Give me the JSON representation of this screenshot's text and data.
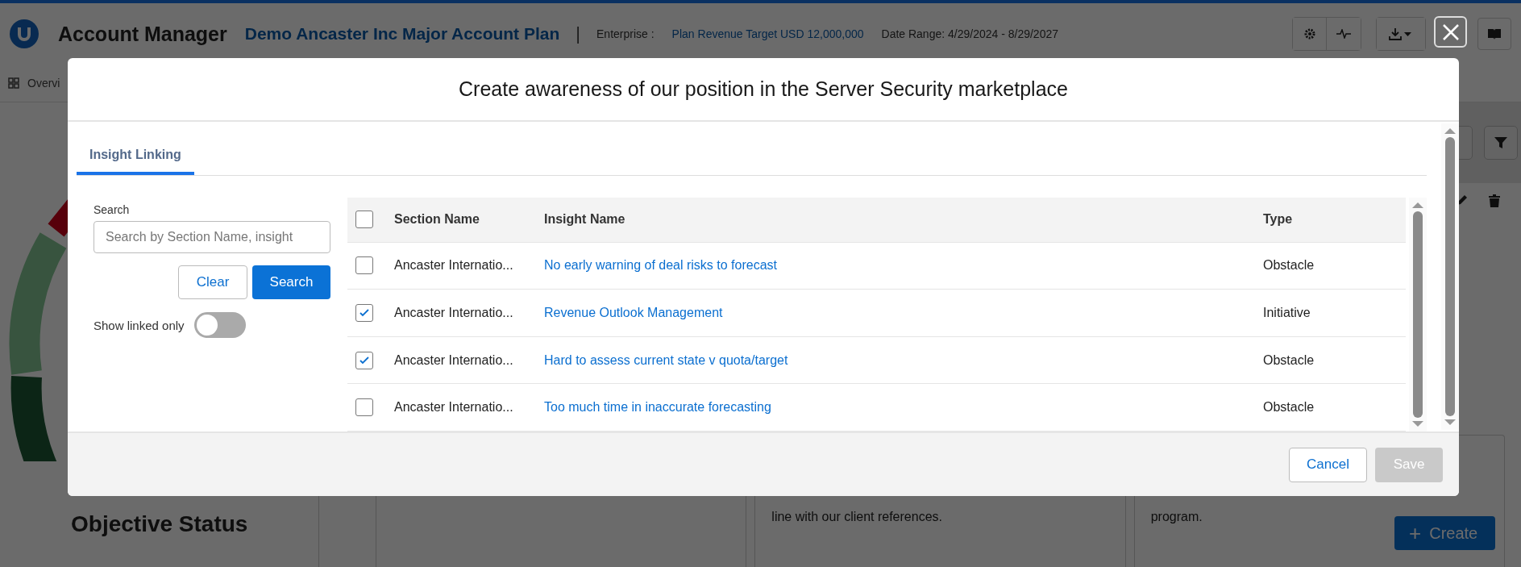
{
  "app": {
    "title": "Account Manager",
    "plan_name": "Demo Ancaster Inc Major Account Plan",
    "separator": "|",
    "enterprise_label": "Enterprise :",
    "revenue_target": "Plan Revenue Target USD 12,000,000",
    "date_range": "Date Range: 4/29/2024 - 8/29/2027"
  },
  "nav": {
    "tab_label": "Overvi"
  },
  "background": {
    "section_title": "Objective Status",
    "card_texts": [
      "line with our client references.",
      "program."
    ],
    "create_button": {
      "icon": "+",
      "label": "Create"
    }
  },
  "modal": {
    "title": "Create awareness of our position in the Server Security marketplace",
    "tabs": [
      {
        "label": "Insight Linking",
        "selected": true
      }
    ],
    "search": {
      "label": "Search",
      "placeholder": "Search by Section Name, insight"
    },
    "clear_button": "Clear",
    "search_button": "Search",
    "show_linked_only": {
      "label": "Show linked only",
      "on": false
    },
    "table": {
      "select_all_checked": false,
      "columns": [
        "Section Name",
        "Insight Name",
        "Type"
      ],
      "rows": [
        {
          "checked": false,
          "section": "Ancaster Internatio...",
          "insight": "No early warning of deal risks to forecast",
          "type": "Obstacle"
        },
        {
          "checked": true,
          "section": "Ancaster Internatio...",
          "insight": "Revenue Outlook Management",
          "type": "Initiative"
        },
        {
          "checked": true,
          "section": "Ancaster Internatio...",
          "insight": "Hard to assess current state v quota/target",
          "type": "Obstacle"
        },
        {
          "checked": false,
          "section": "Ancaster Internatio...",
          "insight": "Too much time in inaccurate forecasting",
          "type": "Obstacle"
        }
      ]
    },
    "footer": {
      "cancel": "Cancel",
      "save": "Save",
      "save_disabled": true
    }
  }
}
